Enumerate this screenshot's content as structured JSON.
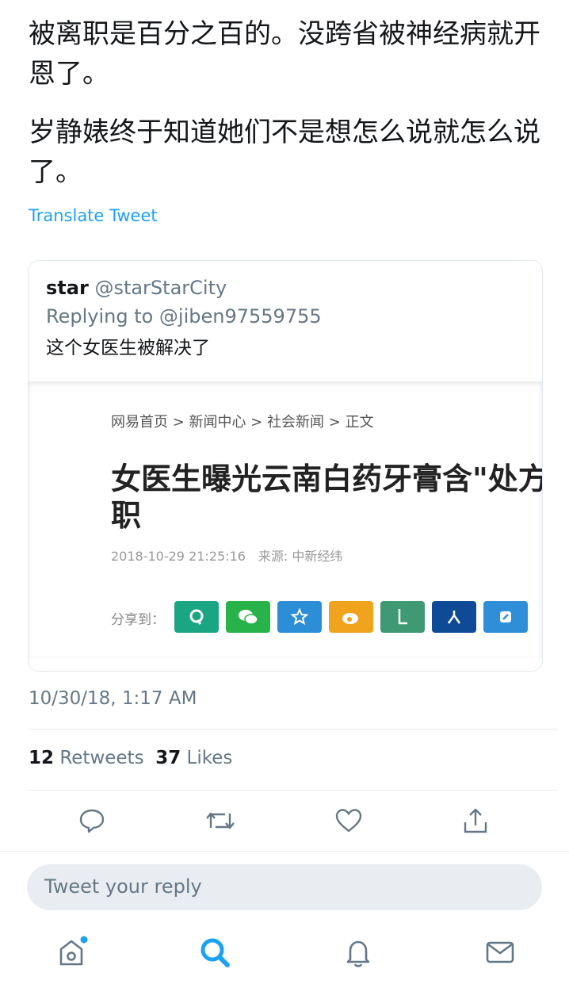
{
  "tweet": {
    "text_1": "被离职是百分之百的。没跨省被神经病就开恩了。",
    "text_2": "岁静婊终于知道她们不是想怎么说就怎么说了。",
    "translate_label": "Translate Tweet",
    "timestamp": "10/30/18, 1:17 AM",
    "retweets_count": "12",
    "retweets_label": "Retweets",
    "likes_count": "37",
    "likes_label": "Likes"
  },
  "quote": {
    "name": "star",
    "handle": "@starStarCity",
    "replying_to": "Replying to @jiben97559755",
    "text": "这个女医生被解决了",
    "image": {
      "breadcrumb": "网易首页 > 新闻中心 > 社会新闻 > 正文",
      "headline_line1": "女医生曝光云南白药牙膏含\"处方",
      "headline_line2": "职",
      "meta": "2018-10-29 21:25:16　来源: 中新经纬",
      "share_label": "分享到：",
      "share_buttons": [
        {
          "icon": "qzone-icon",
          "color": "#1aa683"
        },
        {
          "icon": "wechat-icon",
          "color": "#27b24a"
        },
        {
          "icon": "star-icon",
          "color": "#2b8ed6"
        },
        {
          "icon": "weibo-icon",
          "color": "#f0a31d"
        },
        {
          "icon": "note-icon",
          "color": "#3f9a74"
        },
        {
          "icon": "renren-icon",
          "color": "#0f4a97"
        },
        {
          "icon": "link-icon",
          "color": "#2f8ed8"
        }
      ]
    }
  },
  "reply": {
    "placeholder": "Tweet your reply"
  },
  "colors": {
    "accent": "#1da1f2",
    "muted": "#657786",
    "text": "#14171a"
  }
}
